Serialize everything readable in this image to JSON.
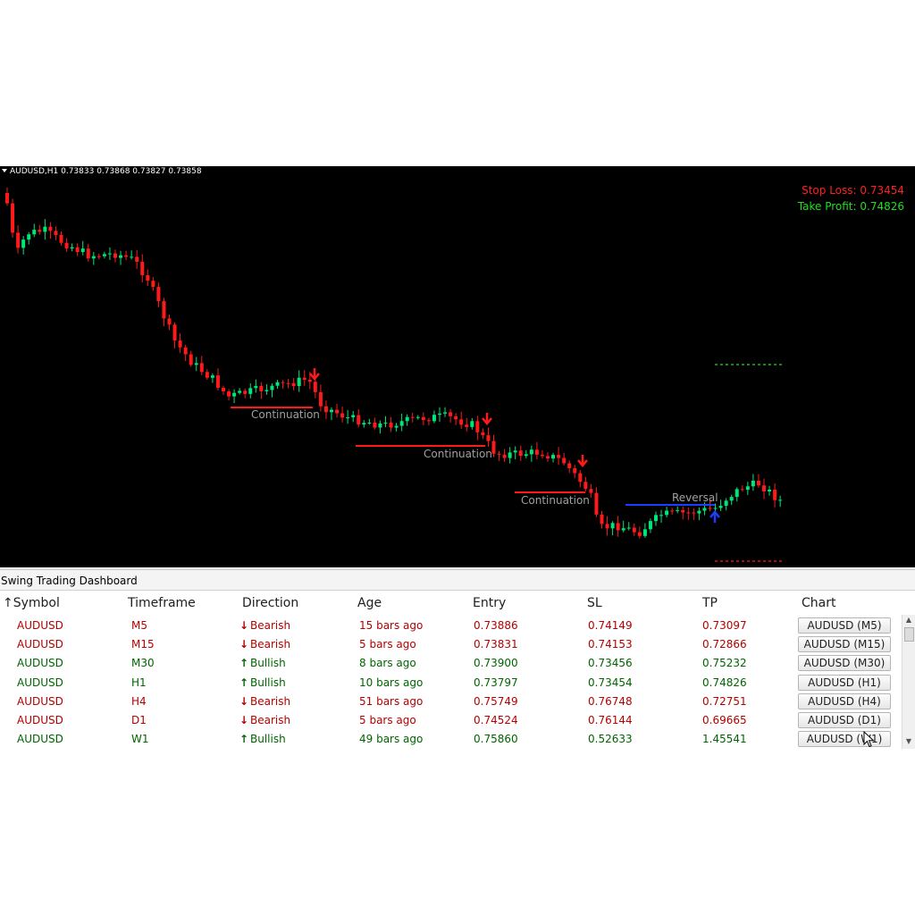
{
  "chart": {
    "symbol_header": "AUDUSD,H1  0.73833 0.73868 0.73827 0.73858",
    "stop_loss_label": "Stop Loss: 0.73454",
    "take_profit_label": "Take Profit: 0.74826",
    "patterns": [
      {
        "label": "Continuation",
        "type": "continuation"
      },
      {
        "label": "Continuation",
        "type": "continuation"
      },
      {
        "label": "Continuation",
        "type": "continuation"
      },
      {
        "label": "Reversal",
        "type": "reversal"
      }
    ],
    "colors": {
      "background": "#000000",
      "bull_candle": "#00e676",
      "bear_candle": "#ff1a1a",
      "continuation_line": "#ff1a1a",
      "reversal_line": "#1e3cff",
      "sl_line": "#ff1a1a",
      "tp_line": "#22dd22"
    }
  },
  "dashboard": {
    "title": "Swing Trading Dashboard",
    "columns": {
      "symbol": "Symbol",
      "timeframe": "Timeframe",
      "direction": "Direction",
      "age": "Age",
      "entry": "Entry",
      "sl": "SL",
      "tp": "TP",
      "chart": "Chart"
    },
    "sort_icon": "arrow-up-icon",
    "rows": [
      {
        "symbol": "AUDUSD",
        "timeframe": "M5",
        "direction": "Bearish",
        "age": "15 bars ago",
        "entry": "0.73886",
        "sl": "0.74149",
        "tp": "0.73097",
        "chart": "AUDUSD (M5)"
      },
      {
        "symbol": "AUDUSD",
        "timeframe": "M15",
        "direction": "Bearish",
        "age": "5 bars ago",
        "entry": "0.73831",
        "sl": "0.74153",
        "tp": "0.72866",
        "chart": "AUDUSD (M15)"
      },
      {
        "symbol": "AUDUSD",
        "timeframe": "M30",
        "direction": "Bullish",
        "age": "8 bars ago",
        "entry": "0.73900",
        "sl": "0.73456",
        "tp": "0.75232",
        "chart": "AUDUSD (M30)"
      },
      {
        "symbol": "AUDUSD",
        "timeframe": "H1",
        "direction": "Bullish",
        "age": "10 bars ago",
        "entry": "0.73797",
        "sl": "0.73454",
        "tp": "0.74826",
        "chart": "AUDUSD (H1)"
      },
      {
        "symbol": "AUDUSD",
        "timeframe": "H4",
        "direction": "Bearish",
        "age": "51 bars ago",
        "entry": "0.75749",
        "sl": "0.76748",
        "tp": "0.72751",
        "chart": "AUDUSD (H4)"
      },
      {
        "symbol": "AUDUSD",
        "timeframe": "D1",
        "direction": "Bearish",
        "age": "5 bars ago",
        "entry": "0.74524",
        "sl": "0.76144",
        "tp": "0.69665",
        "chart": "AUDUSD (D1)"
      },
      {
        "symbol": "AUDUSD",
        "timeframe": "W1",
        "direction": "Bullish",
        "age": "49 bars ago",
        "entry": "0.75860",
        "sl": "0.52633",
        "tp": "1.45541",
        "chart": "AUDUSD (W1)"
      }
    ],
    "colors": {
      "bearish_text": "#b40000",
      "bullish_text": "#006400"
    }
  }
}
